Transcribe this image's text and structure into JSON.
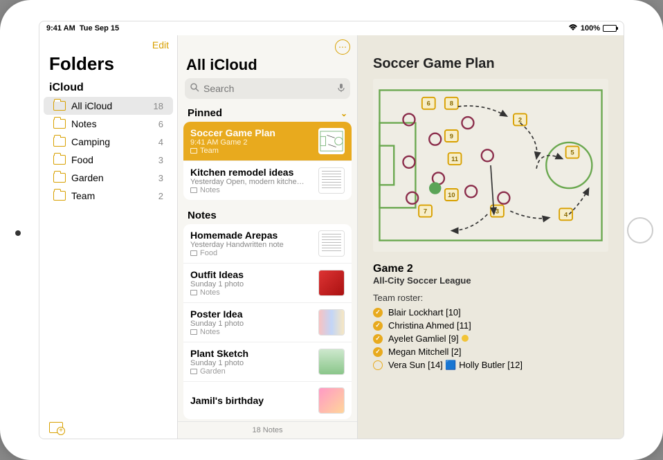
{
  "status": {
    "time": "9:41 AM",
    "date": "Tue Sep 15",
    "battery": "100%"
  },
  "sidebar": {
    "edit_label": "Edit",
    "title": "Folders",
    "section": "iCloud",
    "folders": [
      {
        "name": "All iCloud",
        "count": "18",
        "selected": true
      },
      {
        "name": "Notes",
        "count": "6"
      },
      {
        "name": "Camping",
        "count": "4"
      },
      {
        "name": "Food",
        "count": "3"
      },
      {
        "name": "Garden",
        "count": "3"
      },
      {
        "name": "Team",
        "count": "2"
      }
    ]
  },
  "list": {
    "title": "All iCloud",
    "search_placeholder": "Search",
    "groups": {
      "pinned": "Pinned",
      "notes": "Notes"
    },
    "pinned": [
      {
        "title": "Soccer Game Plan",
        "subtitle": "9:41 AM  Game 2",
        "folder": "Team",
        "selected": true,
        "thumb": "field"
      },
      {
        "title": "Kitchen remodel ideas",
        "subtitle": "Yesterday  Open, modern kitche…",
        "folder": "Notes",
        "thumb": "doc"
      }
    ],
    "notes": [
      {
        "title": "Homemade Arepas",
        "subtitle": "Yesterday  Handwritten note",
        "folder": "Food",
        "thumb": "doc"
      },
      {
        "title": "Outfit Ideas",
        "subtitle": "Sunday  1 photo",
        "folder": "Notes",
        "thumb": "red"
      },
      {
        "title": "Poster Idea",
        "subtitle": "Sunday  1 photo",
        "folder": "Notes",
        "thumb": "people"
      },
      {
        "title": "Plant Sketch",
        "subtitle": "Sunday  1 photo",
        "folder": "Garden",
        "thumb": "plant"
      },
      {
        "title": "Jamil's birthday",
        "subtitle": "",
        "folder": "",
        "thumb": "bday"
      }
    ],
    "footer": "18 Notes"
  },
  "detail": {
    "title": "Soccer Game Plan",
    "game": "Game 2",
    "league": "All-City Soccer League",
    "roster_label": "Team roster:",
    "roster": [
      {
        "name": "Blair Lockhart [10]",
        "checked": true
      },
      {
        "name": "Christina Ahmed [11]",
        "checked": true
      },
      {
        "name": "Ayelet Gamliel [9]",
        "checked": true,
        "dot": true
      },
      {
        "name": "Megan Mitchell [2]",
        "checked": true
      },
      {
        "name": "Vera Sun [14] 🟦 Holly Butler [12]",
        "checked": false
      }
    ],
    "players_boxes": [
      "6",
      "8",
      "2",
      "9",
      "5",
      "11",
      "10",
      "7",
      "3",
      "4"
    ]
  }
}
